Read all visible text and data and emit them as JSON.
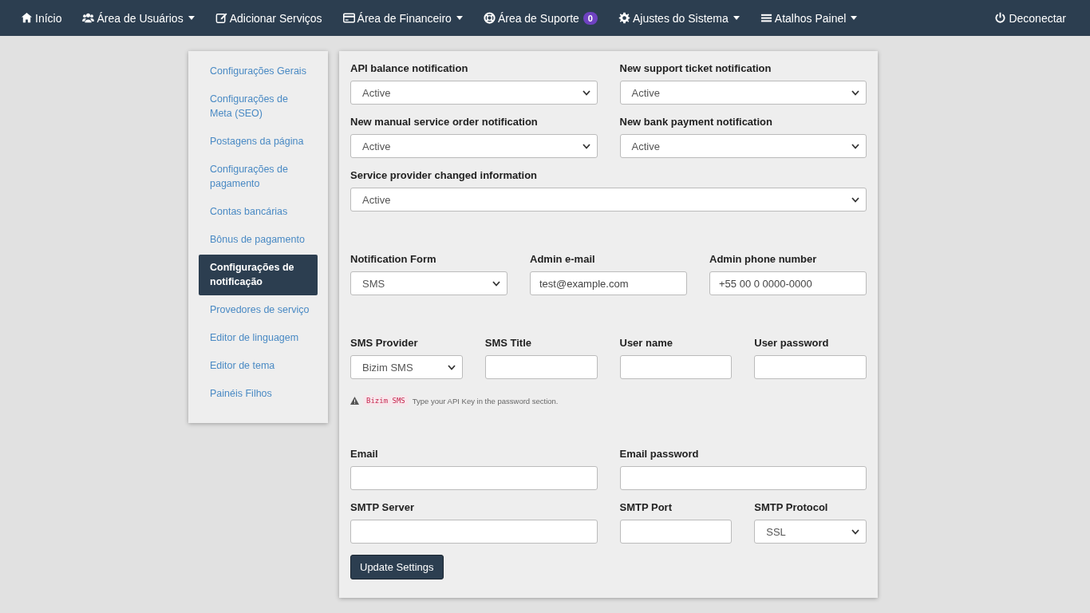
{
  "navbar": {
    "items": [
      {
        "label": "Início",
        "dropdown": false
      },
      {
        "label": "Área de Usuários",
        "dropdown": true
      },
      {
        "label": "Adicionar Serviços",
        "dropdown": false
      },
      {
        "label": "Área de Financeiro",
        "dropdown": true
      },
      {
        "label": "Área de Suporte",
        "dropdown": false,
        "badge": "0"
      },
      {
        "label": "Ajustes do Sistema",
        "dropdown": true
      },
      {
        "label": "Atalhos Painel",
        "dropdown": true
      }
    ],
    "logout": {
      "label": "Deconectar"
    }
  },
  "sidebar": {
    "items": [
      {
        "label": "Configurações Gerais",
        "selected": false
      },
      {
        "label": "Configurações de Meta (SEO)",
        "selected": false
      },
      {
        "label": "Postagens da página",
        "selected": false
      },
      {
        "label": "Configurações de pagamento",
        "selected": false
      },
      {
        "label": "Contas bancárias",
        "selected": false
      },
      {
        "label": "Bônus de pagamento",
        "selected": false
      },
      {
        "label": "Configurações de notificação",
        "selected": true
      },
      {
        "label": "Provedores de serviço",
        "selected": false
      },
      {
        "label": "Editor de linguagem",
        "selected": false
      },
      {
        "label": "Editor de tema",
        "selected": false
      },
      {
        "label": "Painéis Filhos",
        "selected": false
      }
    ]
  },
  "form": {
    "groups": [
      {
        "fields": [
          {
            "kind": "select",
            "label": "API balance notification",
            "value": "Active"
          },
          {
            "kind": "select",
            "label": "New support ticket notification",
            "value": "Active"
          },
          {
            "kind": "select",
            "label": "New manual service order notification",
            "value": "Active"
          },
          {
            "kind": "select",
            "label": "New bank payment notification",
            "value": "Active"
          },
          {
            "kind": "select",
            "label": "Service provider changed information",
            "value": "Active"
          }
        ]
      },
      {
        "fields": [
          {
            "kind": "select",
            "label": "Notification Form",
            "value": "SMS"
          },
          {
            "kind": "input",
            "label": "Admin e-mail",
            "value": "test@example.com"
          },
          {
            "kind": "input",
            "label": "Admin phone number",
            "value": "+55 00 0 0000-0000"
          }
        ]
      },
      {
        "fields": [
          {
            "kind": "select",
            "label": "SMS Provider",
            "value": "Bizim SMS"
          },
          {
            "kind": "input",
            "label": "SMS Title"
          },
          {
            "kind": "input",
            "label": "User name"
          },
          {
            "kind": "input",
            "label": "User password"
          }
        ],
        "note": {
          "code": "Bizim SMS",
          "text": "Type your API Key in the password section."
        }
      },
      {
        "fields": [
          {
            "kind": "input",
            "label": "Email"
          },
          {
            "kind": "input",
            "label": "Email password"
          },
          {
            "kind": "input",
            "label": "SMTP Server"
          },
          {
            "kind": "input",
            "label": "SMTP Port"
          },
          {
            "kind": "select",
            "label": "SMTP Protocol",
            "value": "SSL"
          }
        ]
      }
    ],
    "submit": "Update Settings"
  }
}
